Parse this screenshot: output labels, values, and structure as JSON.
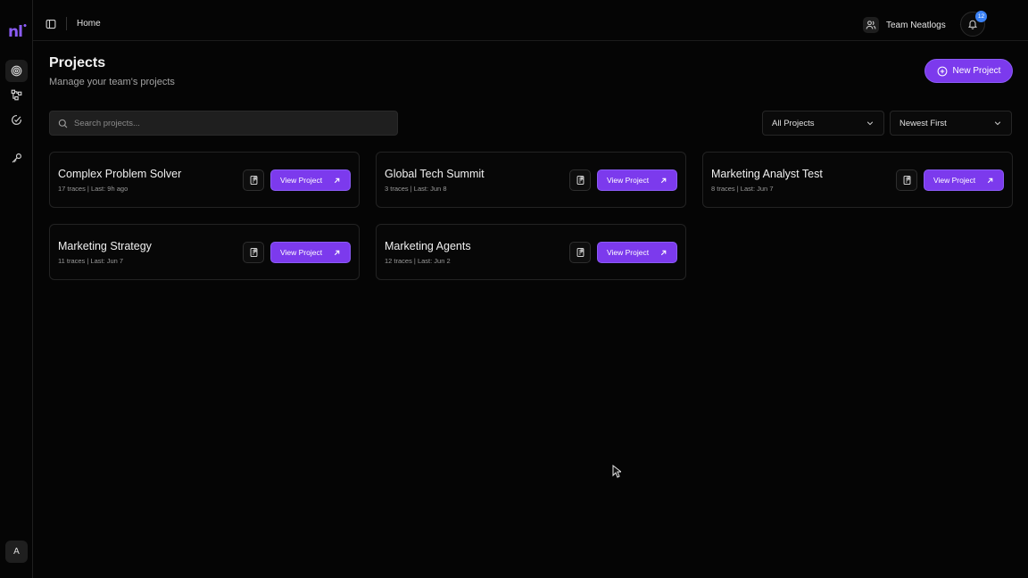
{
  "sidebar": {
    "logo": "nl",
    "items": [
      {
        "name": "projects",
        "icon": "target-icon"
      },
      {
        "name": "workflows",
        "icon": "nodes-icon"
      },
      {
        "name": "evals",
        "icon": "check-target-icon"
      },
      {
        "name": "keys",
        "icon": "key-icon"
      }
    ],
    "avatar": "A"
  },
  "header": {
    "breadcrumb": "Home",
    "team_name": "Team Neatlogs",
    "notification_count": "12"
  },
  "page": {
    "title": "Projects",
    "subtitle": "Manage your team's projects",
    "new_project_label": "New Project"
  },
  "filters": {
    "search_placeholder": "Search projects...",
    "search_value": "",
    "scope": "All Projects",
    "sort": "Newest First"
  },
  "projects": [
    {
      "name": "Complex Problem Solver",
      "meta": "17 traces | Last: 9h ago",
      "action": "View Project"
    },
    {
      "name": "Global Tech Summit",
      "meta": "3 traces | Last: Jun 8",
      "action": "View Project"
    },
    {
      "name": "Marketing Analyst Test",
      "meta": "8 traces | Last: Jun 7",
      "action": "View Project"
    },
    {
      "name": "Marketing Strategy",
      "meta": "11 traces | Last: Jun 7",
      "action": "View Project"
    },
    {
      "name": "Marketing Agents",
      "meta": "12 traces | Last: Jun 2",
      "action": "View Project"
    }
  ],
  "colors": {
    "accent": "#7c3aed",
    "background": "#050505",
    "badge": "#3b82f6"
  }
}
